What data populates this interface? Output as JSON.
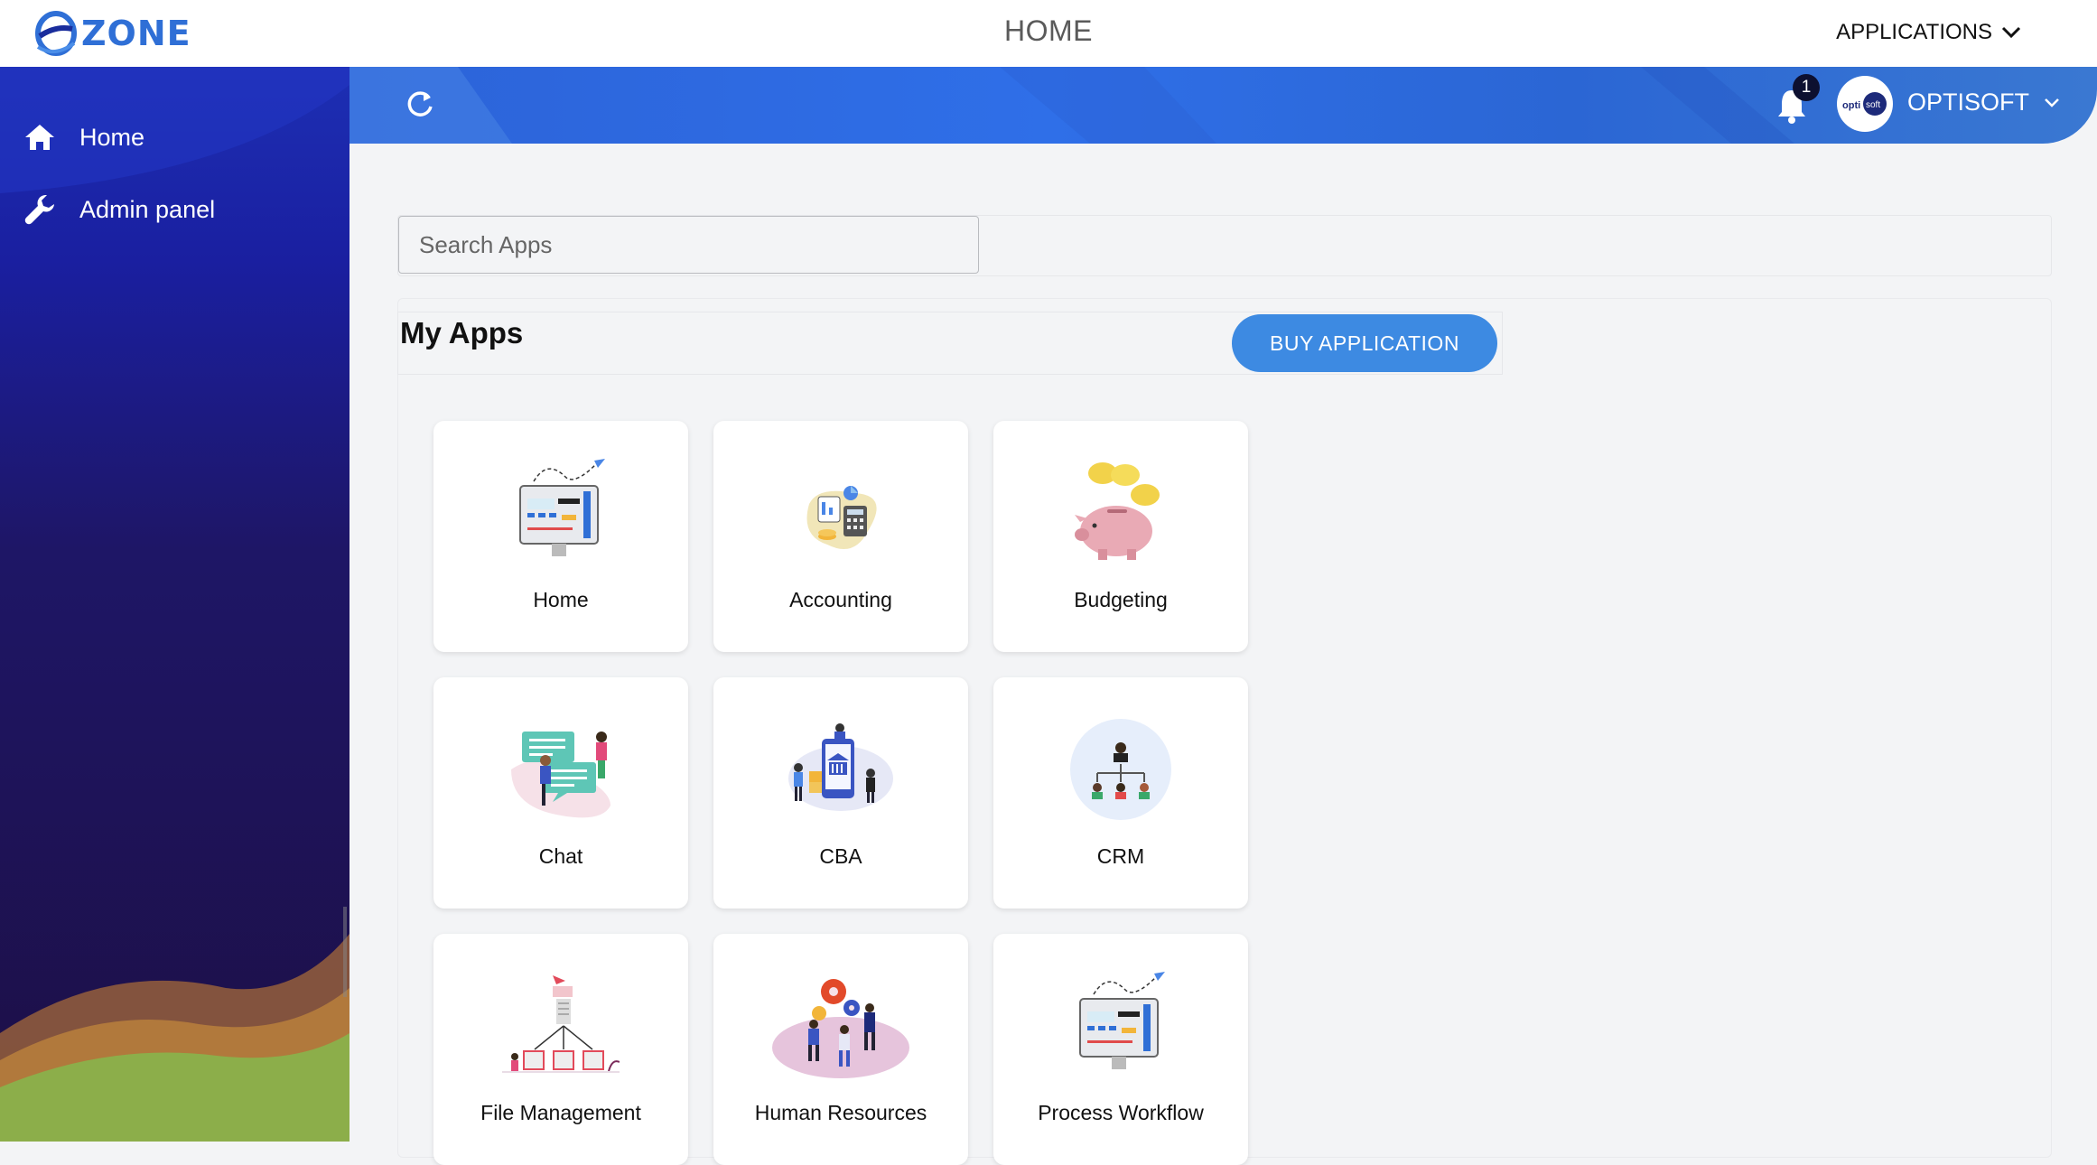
{
  "topbar": {
    "logo_text": "ZONE",
    "page_title": "HOME",
    "applications_label": "APPLICATIONS"
  },
  "sidebar": {
    "items": [
      {
        "label": "Home",
        "icon": "home-icon"
      },
      {
        "label": "Admin panel",
        "icon": "wrench-icon"
      }
    ]
  },
  "header": {
    "notification_count": "1",
    "company_name": "OPTISOFT",
    "avatar_text_left": "opti",
    "avatar_text_right": "soft"
  },
  "search": {
    "placeholder": "Search Apps",
    "value": ""
  },
  "my_apps": {
    "title": "My Apps",
    "buy_button": "BUY APPLICATION",
    "apps": [
      {
        "label": "Home",
        "icon": "dashboard-monitor-icon"
      },
      {
        "label": "Accounting",
        "icon": "calculator-icon"
      },
      {
        "label": "Budgeting",
        "icon": "piggy-bank-icon"
      },
      {
        "label": "Chat",
        "icon": "chat-bubbles-icon"
      },
      {
        "label": "CBA",
        "icon": "bank-building-icon"
      },
      {
        "label": "CRM",
        "icon": "org-chart-icon"
      },
      {
        "label": "File Management",
        "icon": "file-tree-icon"
      },
      {
        "label": "Human Resources",
        "icon": "team-gears-icon"
      },
      {
        "label": "Process Workflow",
        "icon": "workflow-monitor-icon"
      }
    ]
  },
  "colors": {
    "brand": "#2f6fd6",
    "band": "#2f6fe8",
    "buy_button": "#3d8ae2",
    "sidebar_dark": "#1d0f45"
  }
}
